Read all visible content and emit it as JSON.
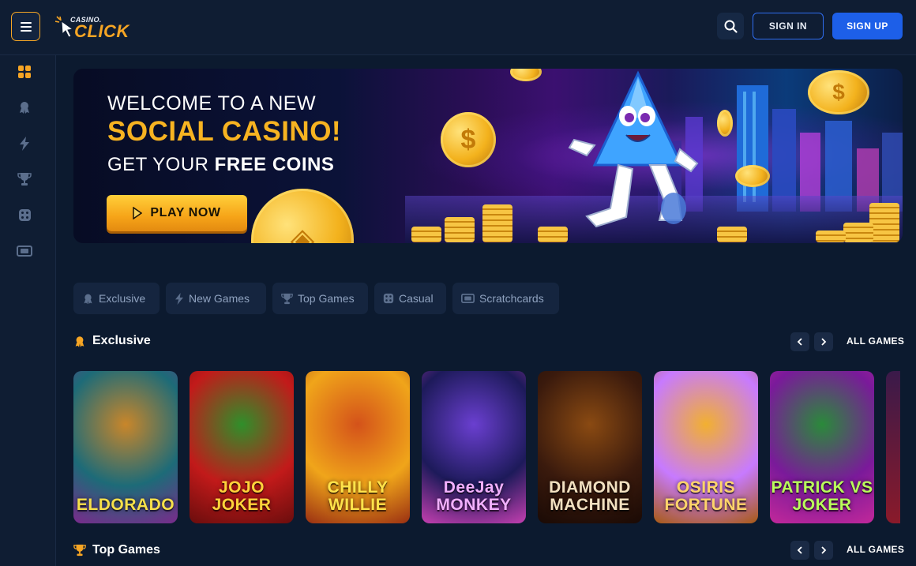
{
  "header": {
    "logo_small": "CASINO.",
    "logo_big": "CLICK",
    "sign_in": "SIGN IN",
    "sign_up": "SIGN UP"
  },
  "sidebar": {
    "items": [
      {
        "icon": "grid-icon",
        "active": true
      },
      {
        "icon": "award-icon"
      },
      {
        "icon": "bolt-icon"
      },
      {
        "icon": "trophy-icon"
      },
      {
        "icon": "dice-icon"
      },
      {
        "icon": "ticket-icon"
      }
    ]
  },
  "banner": {
    "line1": "WELCOME TO A NEW",
    "line2": "SOCIAL CASINO!",
    "line3_prefix": "GET YOUR ",
    "line3_bold": "FREE COINS",
    "cta": "PLAY NOW"
  },
  "categories": [
    {
      "label": "Exclusive",
      "icon": "award-icon"
    },
    {
      "label": "New Games",
      "icon": "bolt-icon"
    },
    {
      "label": "Top Games",
      "icon": "trophy-icon"
    },
    {
      "label": "Casual",
      "icon": "dice-icon"
    },
    {
      "label": "Scratchcards",
      "icon": "ticket-icon"
    }
  ],
  "sections": {
    "exclusive": {
      "title": "Exclusive",
      "all_games": "ALL GAMES"
    },
    "top_games": {
      "title": "Top Games",
      "all_games": "ALL GAMES"
    }
  },
  "games": [
    {
      "name": "ELDORADO",
      "colors": [
        "#1d6b78",
        "#c9862a",
        "#7a2a8c"
      ],
      "text_color": "#f6e04a"
    },
    {
      "name": "JOJO JOKER",
      "colors": [
        "#c21a1a",
        "#2f8f2a",
        "#6a0d0d"
      ],
      "text_color": "#ffd23a"
    },
    {
      "name": "CHILLY WILLIE",
      "colors": [
        "#f0a51a",
        "#d4521a",
        "#9a2f12"
      ],
      "text_color": "#ffe24a"
    },
    {
      "name": "DeeJay MONKEY",
      "colors": [
        "#1d1a5a",
        "#6a3fd0",
        "#c43fb0"
      ],
      "text_color": "#f2b0ff"
    },
    {
      "name": "DIAMOND MACHINE",
      "colors": [
        "#3a1a0d",
        "#8a4a12",
        "#1a0a05"
      ],
      "text_color": "#f2e0c0"
    },
    {
      "name": "OSIRIS FORTUNE",
      "colors": [
        "#c77aff",
        "#f2b030",
        "#a85a12"
      ],
      "text_color": "#ffd46a"
    },
    {
      "name": "PATRICK VS JOKER",
      "colors": [
        "#7a1a9a",
        "#2a8a3a",
        "#c2289a"
      ],
      "text_color": "#b8ff5a"
    }
  ]
}
